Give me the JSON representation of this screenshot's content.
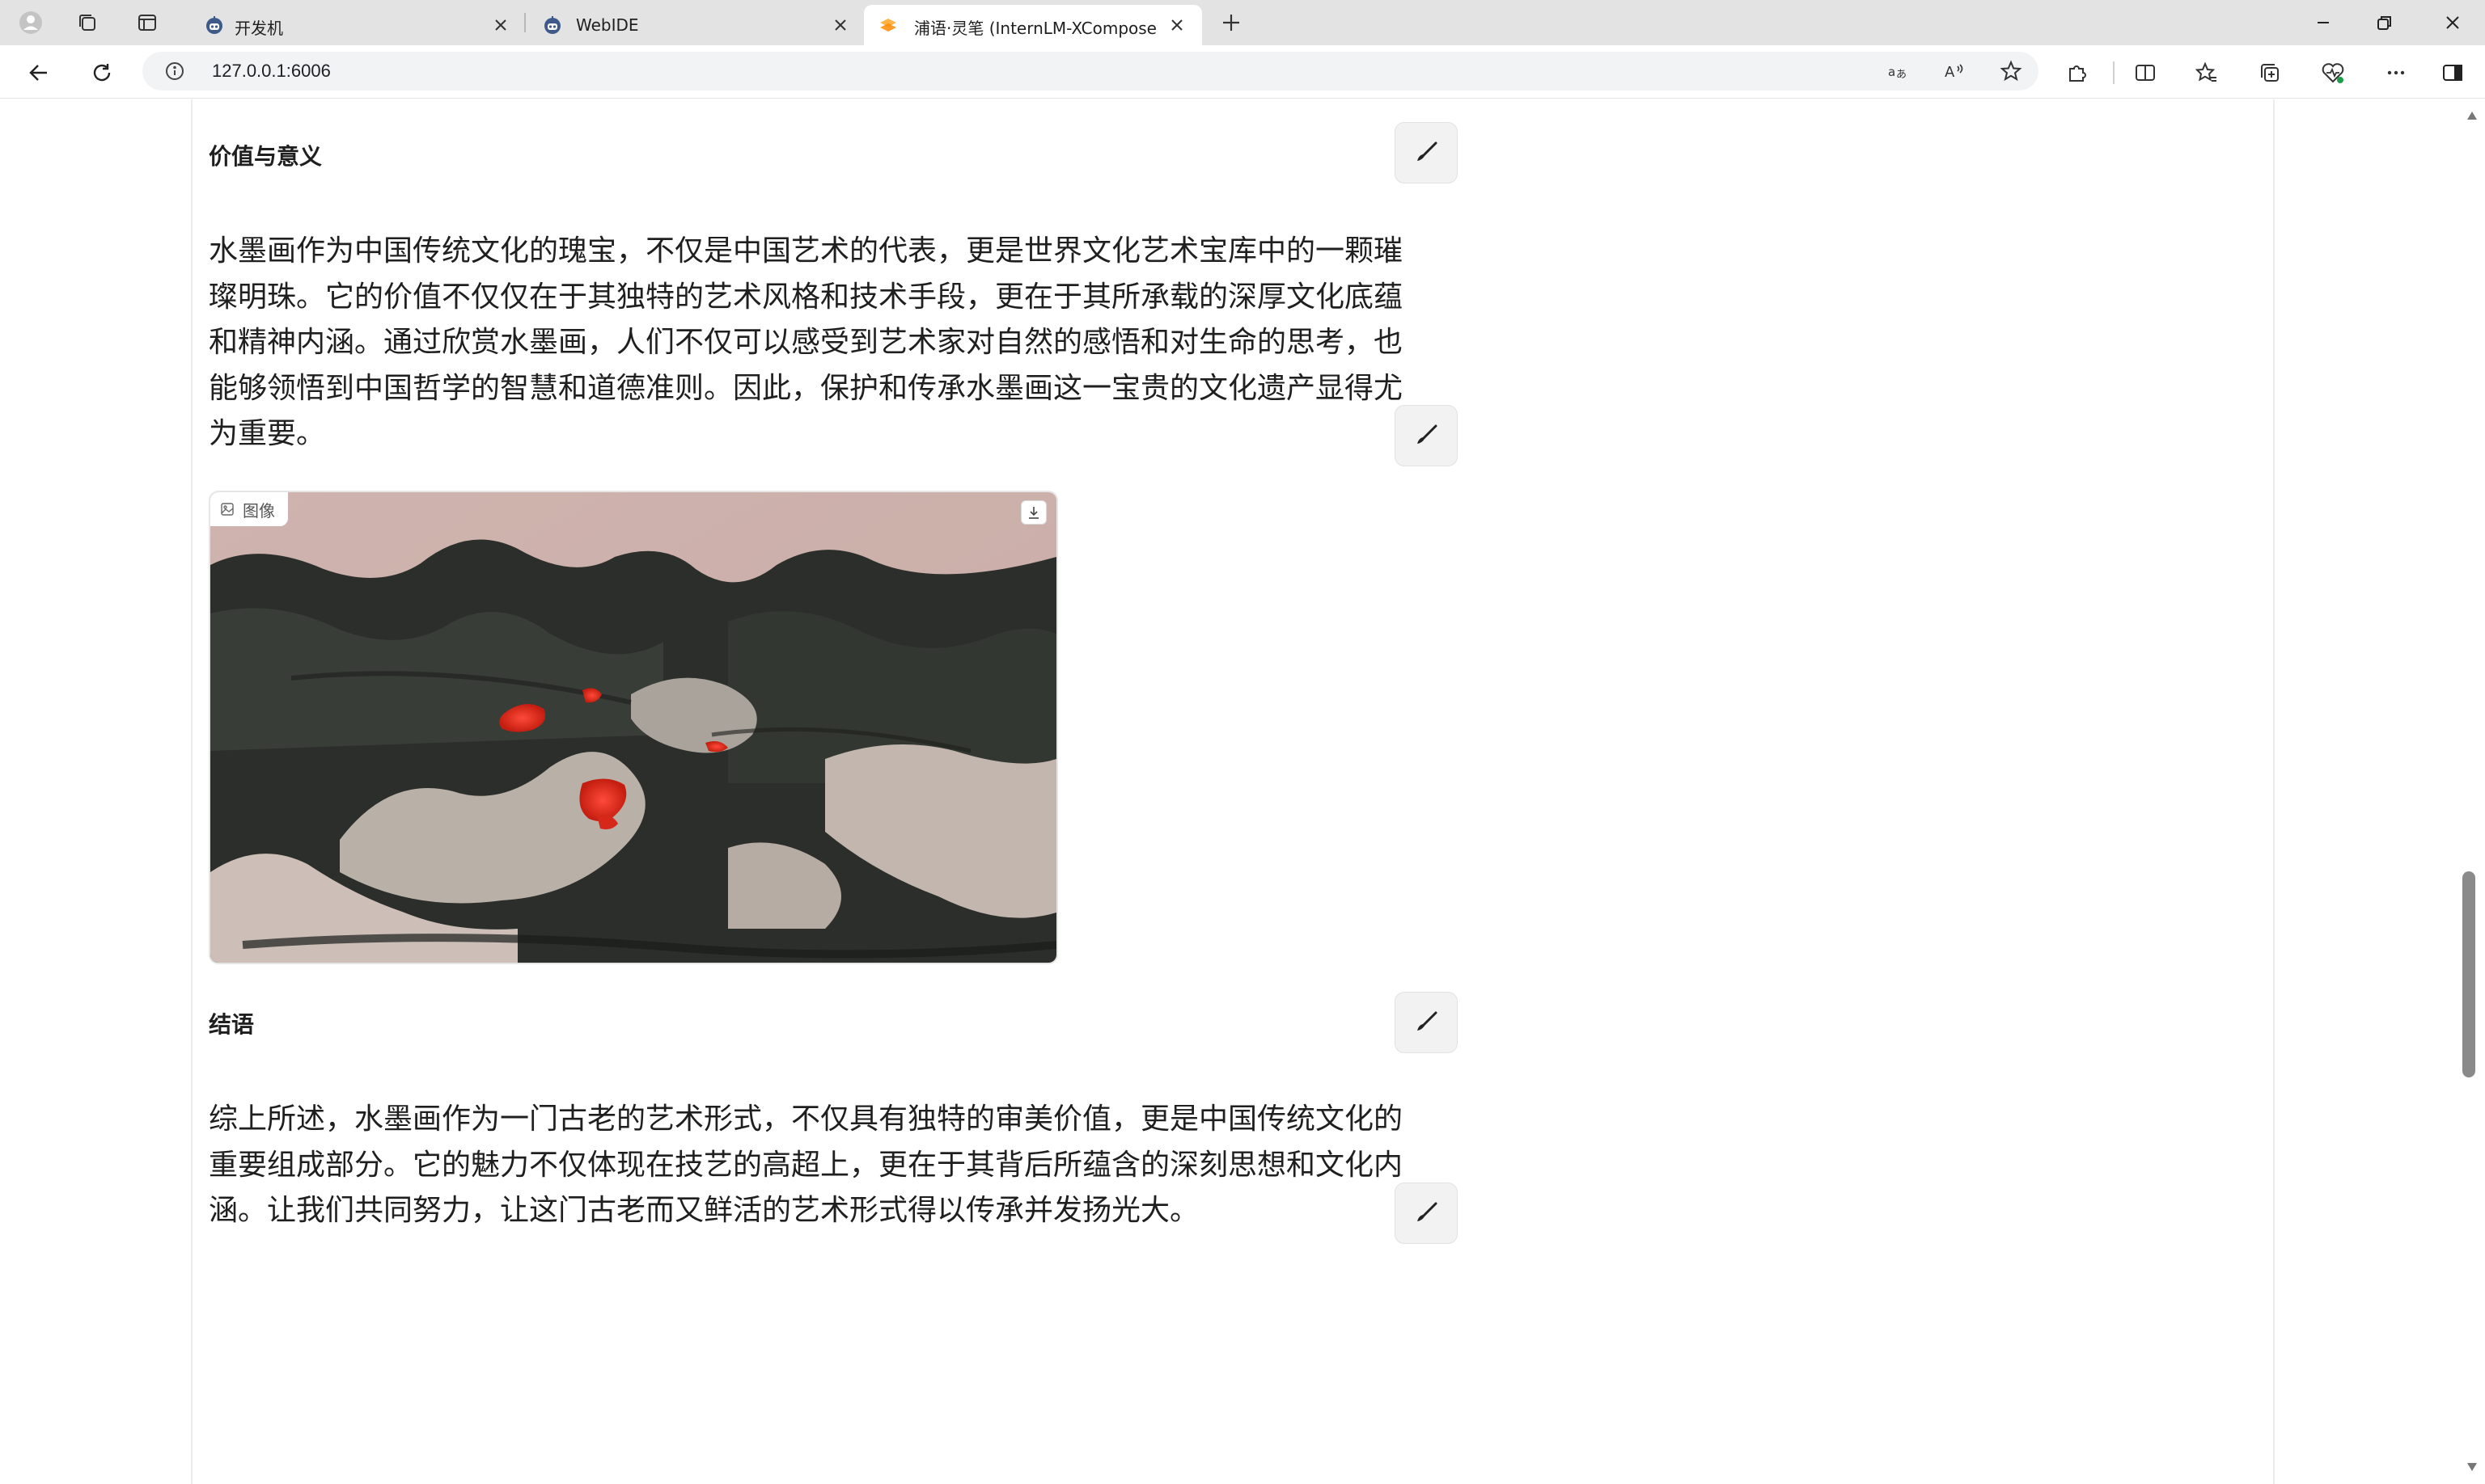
{
  "browser": {
    "tabs": [
      {
        "title": "开发机",
        "active": false,
        "favicon": "robot-favicon-icon"
      },
      {
        "title": "WebIDE",
        "active": false,
        "favicon": "robot-favicon-icon"
      },
      {
        "title": "浦语·灵笔 (InternLM-XComposer",
        "active": true,
        "favicon": "gradio-favicon-icon"
      }
    ],
    "address": "127.0.0.1:6006",
    "accent_color": "#ff8a00"
  },
  "content": {
    "section1_heading": "价值与意义",
    "section1_lines": [
      "水墨画作为中国传统文化的瑰宝，不仅是中国艺术的代表，更是世界文化艺术宝库中的一颗璀",
      "璨明珠。它的价值不仅仅在于其独特的艺术风格和技术手段，更在于其所承载的深厚文化底蕴",
      "和精神内涵。通过欣赏水墨画，人们不仅可以感受到艺术家对自然的感悟和对生命的思考，也",
      "能够领悟到中国哲学的智慧和道德准则。因此，保护和传承水墨画这一宝贵的文化遗产显得尤",
      "为重要。"
    ],
    "image_label": "图像",
    "section2_heading": "结语",
    "section2_lines": [
      "综上所述，水墨画作为一门古老的艺术形式，不仅具有独特的审美价值，更是中国传统文化的",
      "重要组成部分。它的魅力不仅体现在技艺的高超上，更在于其背后所蕴含的深刻思想和文化内",
      "涵。让我们共同努力，让这门古老而又鲜活的艺术形式得以传承并发扬光大。"
    ]
  }
}
